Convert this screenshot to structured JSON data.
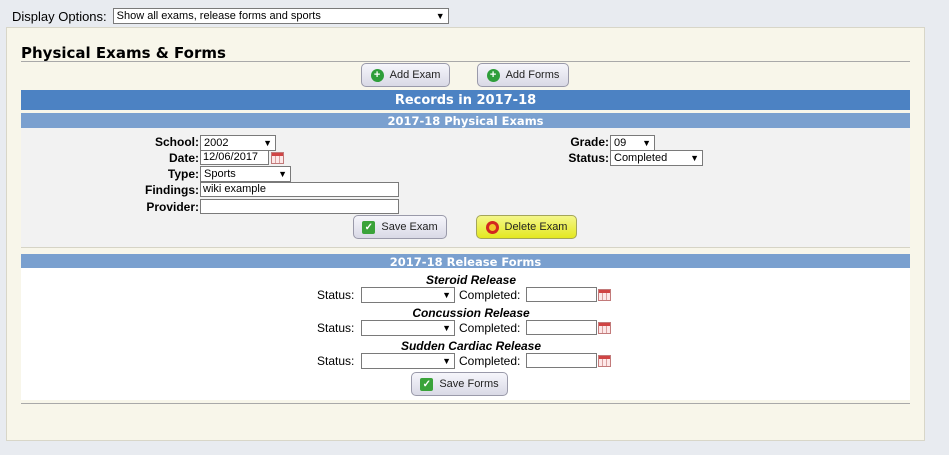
{
  "display_options": {
    "label": "Display Options:",
    "selected": "Show all exams, release forms and sports"
  },
  "page_title": "Physical Exams & Forms",
  "buttons": {
    "add_exam": "Add Exam",
    "add_forms": "Add Forms",
    "save_exam": "Save Exam",
    "delete_exam": "Delete Exam",
    "save_forms": "Save Forms"
  },
  "records_header": "Records in 2017-18",
  "exams_header": "2017-18 Physical Exams",
  "exam": {
    "school_label": "School:",
    "school": "2002",
    "date_label": "Date:",
    "date": "12/06/2017",
    "type_label": "Type:",
    "type": "Sports",
    "findings_label": "Findings:",
    "findings": "wiki example",
    "provider_label": "Provider:",
    "provider": "",
    "grade_label": "Grade:",
    "grade": "09",
    "status_label": "Status:",
    "status": "Completed"
  },
  "forms_header": "2017-18 Release Forms",
  "forms": [
    {
      "title": "Steroid Release",
      "status_label": "Status:",
      "status": "",
      "completed_label": "Completed:",
      "completed": ""
    },
    {
      "title": "Concussion Release",
      "status_label": "Status:",
      "status": "",
      "completed_label": "Completed:",
      "completed": ""
    },
    {
      "title": "Sudden Cardiac Release",
      "status_label": "Status:",
      "status": "",
      "completed_label": "Completed:",
      "completed": ""
    }
  ],
  "icons": {
    "dropdown": "chevron-down-icon",
    "calendar": "calendar-icon",
    "add": "plus-circle-icon",
    "save": "checkmark-icon",
    "delete": "stop-icon"
  },
  "colors": {
    "header_bar": "#4c82c3",
    "sub_bar": "#7aa0cf",
    "panel_bg": "#f8f6ea",
    "highlight": "#e4e820"
  }
}
